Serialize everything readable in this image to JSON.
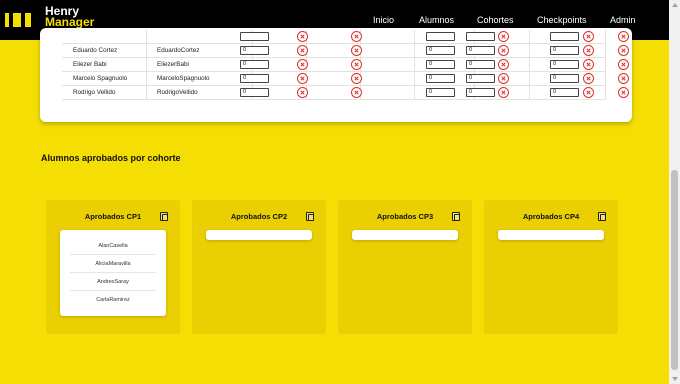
{
  "navbar": {
    "logo": {
      "line1": "Henry",
      "line2": "Manager"
    },
    "links": [
      {
        "label": "Inicio"
      },
      {
        "label": "Alumnos"
      },
      {
        "label": "Cohortes"
      },
      {
        "label": "Checkpoints"
      },
      {
        "label": "Admin"
      }
    ]
  },
  "students_table": {
    "rows": [
      {
        "name": "",
        "username": "",
        "grades": [
          "",
          "",
          "",
          ""
        ]
      },
      {
        "name": "Eduardo Cortez",
        "username": "EduardoCortez",
        "grades": [
          "0",
          "0",
          "0",
          "0"
        ]
      },
      {
        "name": "Eliezer Babi",
        "username": "EliezerBabi",
        "grades": [
          "0",
          "0",
          "0",
          "0"
        ]
      },
      {
        "name": "Marcelo Spagnuolo",
        "username": "MarceloSpagnuolo",
        "grades": [
          "0",
          "0",
          "0",
          "0"
        ]
      },
      {
        "name": "Rodrigo Vellido",
        "username": "RodrigoVellido",
        "grades": [
          "0",
          "0",
          "0",
          "0"
        ]
      }
    ]
  },
  "approved_section": {
    "title": "Alumnos aprobados por cohorte",
    "panels": [
      {
        "title": "Aprobados CP1",
        "students": [
          "AlanCasella",
          "AliciaMaravilla",
          "AndresSaray",
          "CarlaRamirez"
        ]
      },
      {
        "title": "Aprobados CP2",
        "students": []
      },
      {
        "title": "Aprobados CP3",
        "students": []
      },
      {
        "title": "Aprobados CP4",
        "students": []
      }
    ]
  },
  "colors": {
    "brand_yellow": "#f5de04",
    "panel_yellow": "#ead002",
    "navbar": "#000000",
    "reject_red": "#d8342c"
  }
}
